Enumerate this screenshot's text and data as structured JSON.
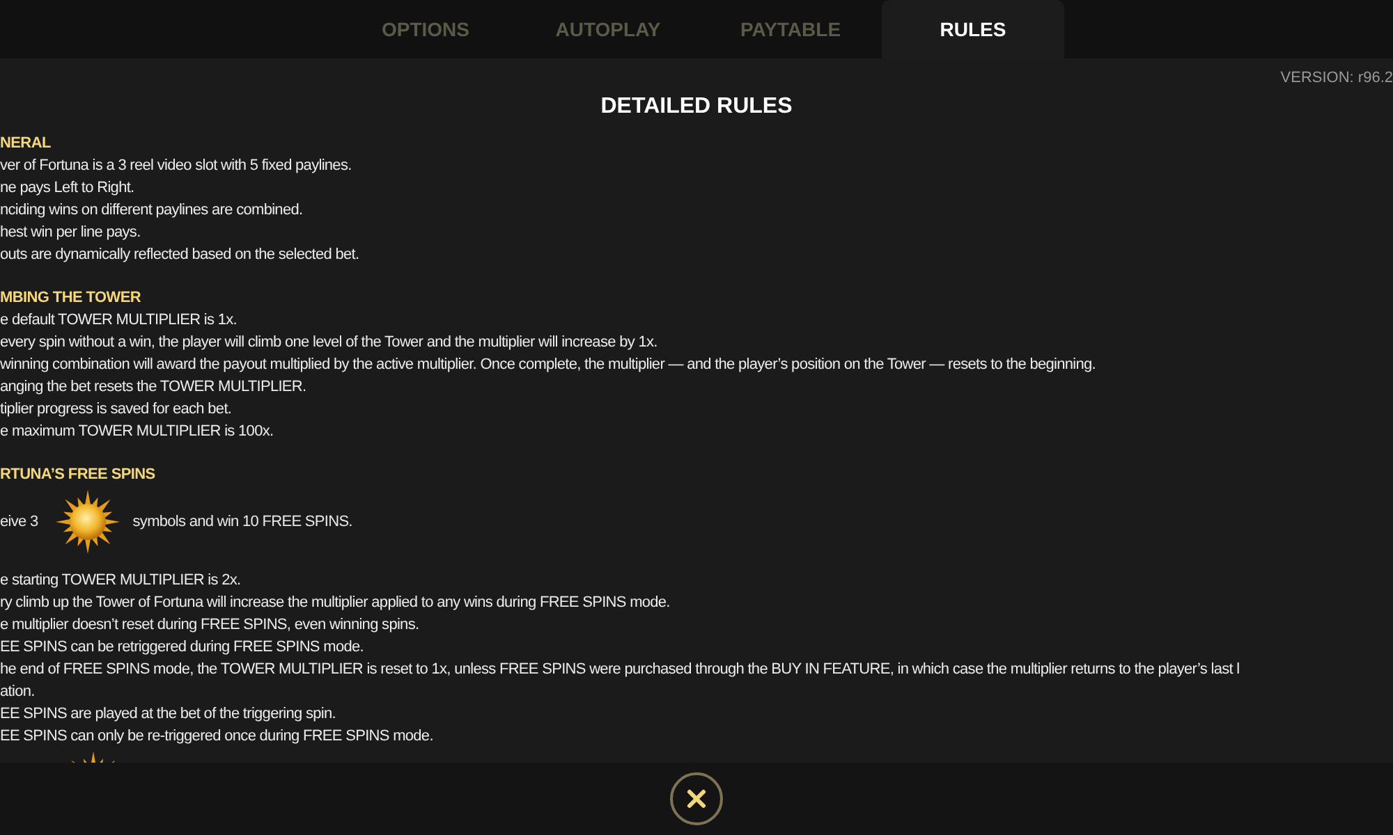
{
  "tabs": [
    {
      "label": "OPTIONS",
      "selected": false
    },
    {
      "label": "AUTOPLAY",
      "selected": false
    },
    {
      "label": "PAYTABLE",
      "selected": false
    },
    {
      "label": "RULES",
      "selected": true
    }
  ],
  "version": "VERSION: r96.2",
  "title": "DETAILED RULES",
  "sections": [
    {
      "heading": "NERAL",
      "items": [
        {
          "kind": "text",
          "text": "ver of Fortuna is a 3 reel video slot with 5 fixed paylines."
        },
        {
          "kind": "text",
          "text": "ne pays Left to Right."
        },
        {
          "kind": "text",
          "text": "nciding wins on different paylines are combined."
        },
        {
          "kind": "text",
          "text": "hest win per line pays."
        },
        {
          "kind": "text",
          "text": "outs are dynamically reflected based on the selected bet."
        }
      ]
    },
    {
      "heading": "MBING THE TOWER",
      "items": [
        {
          "kind": "text",
          "text": "e default TOWER MULTIPLIER is 1x."
        },
        {
          "kind": "text",
          "text": "every spin without a win, the player will climb one level of the Tower and the multiplier will increase by 1x."
        },
        {
          "kind": "text",
          "text": "winning combination will award the payout multiplied by the active multiplier. Once complete, the multiplier — and the player’s position on the Tower — resets to the beginning."
        },
        {
          "kind": "text",
          "text": "anging the bet resets the TOWER MULTIPLIER."
        },
        {
          "kind": "text",
          "text": "tiplier progress is saved for each bet."
        },
        {
          "kind": "text",
          "text": "e maximum TOWER MULTIPLIER is 100x."
        }
      ]
    },
    {
      "heading": "RTUNA’S FREE SPINS",
      "items": [
        {
          "kind": "symbol_line",
          "before": "eive 3",
          "after": "symbols and win 10 FREE SPINS."
        },
        {
          "kind": "text",
          "text": "e starting TOWER MULTIPLIER is 2x."
        },
        {
          "kind": "text",
          "text": "ry climb up the Tower of Fortuna will increase the multiplier applied to any wins during FREE SPINS mode."
        },
        {
          "kind": "text",
          "text": "e multiplier doesn’t reset during FREE SPINS, even winning spins."
        },
        {
          "kind": "text",
          "text": "EE SPINS can be retriggered during FREE SPINS mode."
        },
        {
          "kind": "text",
          "text": "he end of FREE SPINS mode, the TOWER MULTIPLIER is reset to 1x, unless FREE SPINS were purchased through the BUY IN FEATURE, in which case the multiplier returns to the player’s last l"
        },
        {
          "kind": "text",
          "text": "ation."
        },
        {
          "kind": "text",
          "text": "EE SPINS are played at the bet of the triggering spin."
        },
        {
          "kind": "text",
          "text": "EE SPINS can only be re-triggered once during FREE SPINS mode."
        },
        {
          "kind": "symbol"
        }
      ]
    }
  ]
}
